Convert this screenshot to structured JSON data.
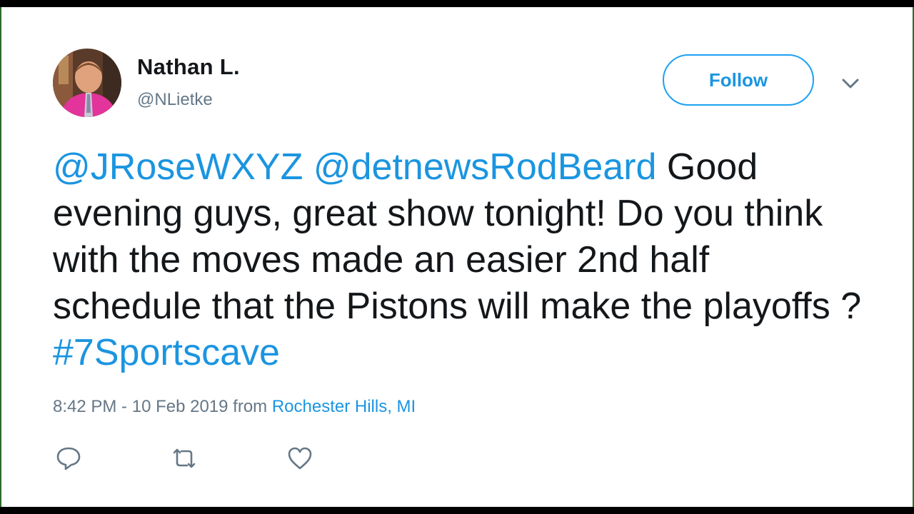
{
  "user": {
    "name": "Nathan L.",
    "handle": "@NLietke"
  },
  "follow_button": {
    "label": "Follow"
  },
  "tweet": {
    "mention_1": "@JRoseWXYZ",
    "mention_2": "@detnewsRodBeard",
    "body": " Good evening guys, great show tonight! Do you think with the moves made an easier 2nd half schedule that the Pistons will make the playoffs ? ",
    "hashtag": "#7Sportscave"
  },
  "meta": {
    "time": "8:42 PM",
    "separator": " - ",
    "date": "10 Feb 2019",
    "from_label": " from ",
    "location": "Rochester Hills, MI"
  },
  "icons": {
    "reply": "reply-icon",
    "retweet": "retweet-icon",
    "like": "heart-icon",
    "caret": "chevron-down-icon"
  },
  "colors": {
    "accent": "#1da1f2",
    "link": "#1b95e0",
    "text": "#14171a",
    "muted": "#657786"
  }
}
